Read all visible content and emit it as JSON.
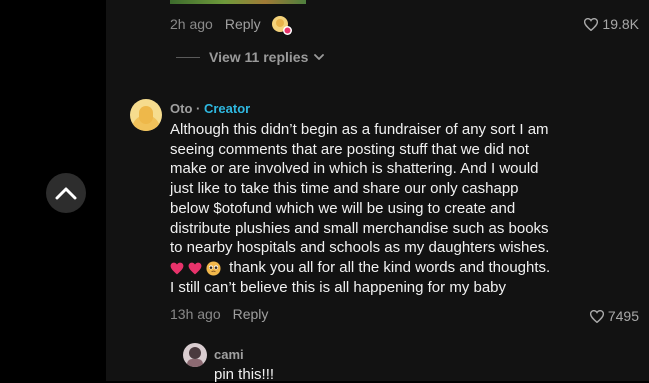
{
  "comment_top": {
    "time": "2h ago",
    "reply_label": "Reply",
    "likes": "19.8K"
  },
  "view_replies": {
    "label": "View 11 replies"
  },
  "comment_main": {
    "author": "Oto",
    "separator": "·",
    "badge": "Creator",
    "text_lines": [
      "Although this didn’t begin as a fundraiser of any sort I am",
      "seeing comments that are posting stuff that we did not",
      "make or are involved in which is shattering. And I would",
      "just like to take this time and share our only cashapp",
      "below $otofund which we will be using to create and",
      "distribute plushies and small merchandise such as books",
      "to nearby hospitals and schools as my daughters wishes."
    ],
    "emoji_line_text": "thank you all for all the kind words and thoughts.",
    "last_line": "I still can’t believe this is all happening for my baby",
    "time": "13h ago",
    "reply_label": "Reply",
    "likes": "7495"
  },
  "reply": {
    "author": "cami",
    "text": "pin this!!!"
  },
  "colors": {
    "background": "#121212",
    "text": "#f1f1f1",
    "muted": "#8a8a8a",
    "creator_accent": "#2fb8e0",
    "heart_emoji": "#e8336b"
  },
  "icons": {
    "scroll_up": "chevron-up-icon",
    "like": "heart-outline-icon",
    "expand": "chevron-down-icon"
  }
}
